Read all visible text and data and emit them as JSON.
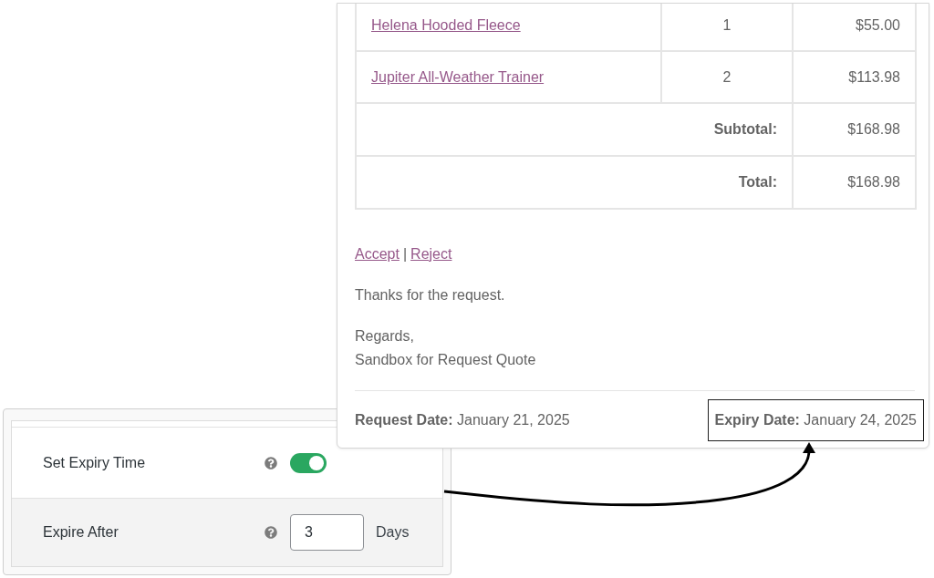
{
  "email": {
    "items": [
      {
        "product": "Helena Hooded Fleece",
        "quantity": "1",
        "price": "$55.00"
      },
      {
        "product": "Jupiter All-Weather Trainer",
        "quantity": "2",
        "price": "$113.98"
      }
    ],
    "totals": [
      {
        "label": "Subtotal:",
        "value": "$168.98"
      },
      {
        "label": "Total:",
        "value": "$168.98"
      }
    ],
    "actions": [
      "Accept",
      "Reject"
    ],
    "action_separator": "|",
    "message": "Thanks for the request.",
    "signoff": [
      "Regards,",
      "Sandbox for Request Quote"
    ],
    "dates": [
      {
        "text": "**Request Date:** January 21, 2025",
        "highlighted": false
      },
      {
        "text": "**Expiry Date:** January 24, 2025",
        "highlighted": true
      }
    ]
  },
  "settings": {
    "rows": [
      {
        "kind": "toggle",
        "label": "Set Expiry Time",
        "on": true
      },
      {
        "kind": "number",
        "label": "Expire After",
        "value": "3",
        "unit": "Days"
      }
    ]
  }
}
